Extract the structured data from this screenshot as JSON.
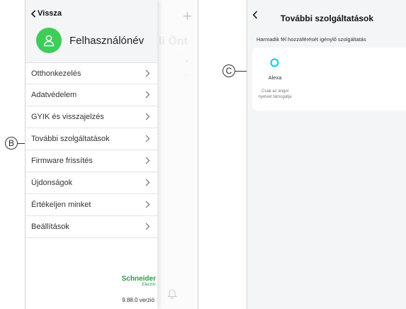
{
  "left_screen": {
    "back_label": "Vissza",
    "username": "Felhasználónév",
    "menu_items": [
      {
        "label": "Otthonkezelés"
      },
      {
        "label": "Adatvédelem"
      },
      {
        "label": "GYIK és visszajelzés"
      },
      {
        "label": "További szolgáltatások"
      },
      {
        "label": "Firmware frissítés"
      },
      {
        "label": "Újdonságok"
      },
      {
        "label": "Értékeljen minket"
      },
      {
        "label": "Beállítások"
      }
    ],
    "brand_name": "Schneider",
    "brand_sub": "Electric",
    "version": "9.88.0 verzió",
    "background_fragment": "li Önt"
  },
  "right_screen": {
    "title": "További szolgáltatások",
    "section_label": "Harmadik fél hozzáférését igénylő szolgáltatás",
    "service": {
      "name": "Alexa",
      "note": "Csak az angol nyelvet támogatja"
    }
  },
  "callouts": {
    "b": "B",
    "c": "C"
  },
  "colors": {
    "brand_green": "#3dcd58",
    "alexa_blue": "#00caff"
  }
}
